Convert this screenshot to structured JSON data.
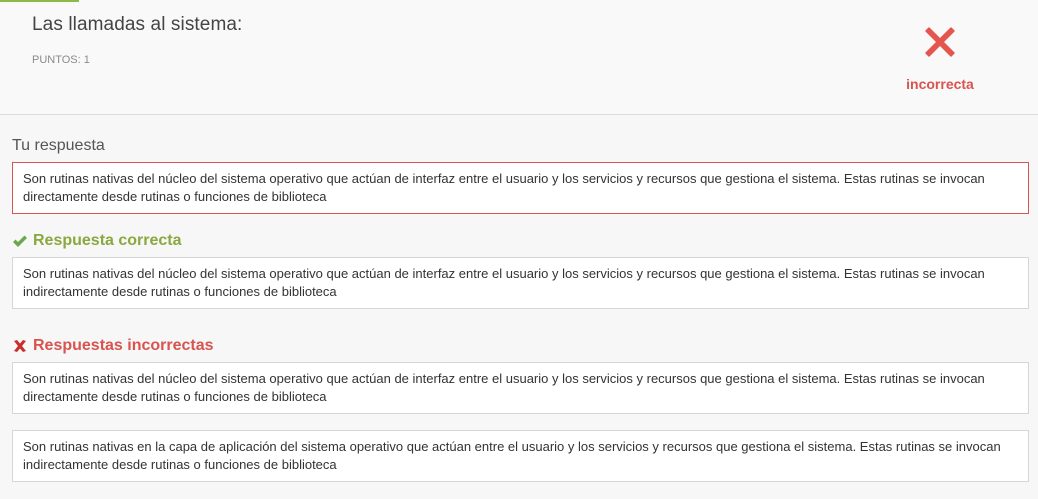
{
  "question": {
    "title": "Las llamadas al sistema:",
    "points": "PUNTOS: 1"
  },
  "result": {
    "icon": "red-x-icon",
    "label": "incorrecta",
    "color": "#d9534f"
  },
  "your_answer": {
    "label": "Tu respuesta",
    "text": "Son rutinas nativas del núcleo del sistema operativo que actúan de interfaz entre el usuario y los servicios y recursos que gestiona el sistema. Estas rutinas se invocan directamente desde rutinas o funciones de biblioteca"
  },
  "correct": {
    "label": "Respuesta correcta",
    "icon": "green-check-icon",
    "color": "#8aa83f",
    "text": "Son rutinas nativas del núcleo del sistema operativo que actúan de interfaz entre el usuario y los servicios y recursos que gestiona el sistema. Estas rutinas se invocan indirectamente desde rutinas o funciones de biblioteca"
  },
  "incorrect": {
    "label": "Respuestas incorrectas",
    "icon": "red-x-icon",
    "items": [
      "Son rutinas nativas del núcleo del sistema operativo que actúan de interfaz entre el usuario y los servicios y recursos que gestiona el sistema. Estas rutinas se invocan directamente desde rutinas o funciones de biblioteca",
      "Son rutinas nativas en la capa de aplicación del sistema operativo que actúan entre el usuario y los servicios y recursos que gestiona el sistema. Estas rutinas se invocan indirectamente desde rutinas o funciones de biblioteca"
    ]
  }
}
